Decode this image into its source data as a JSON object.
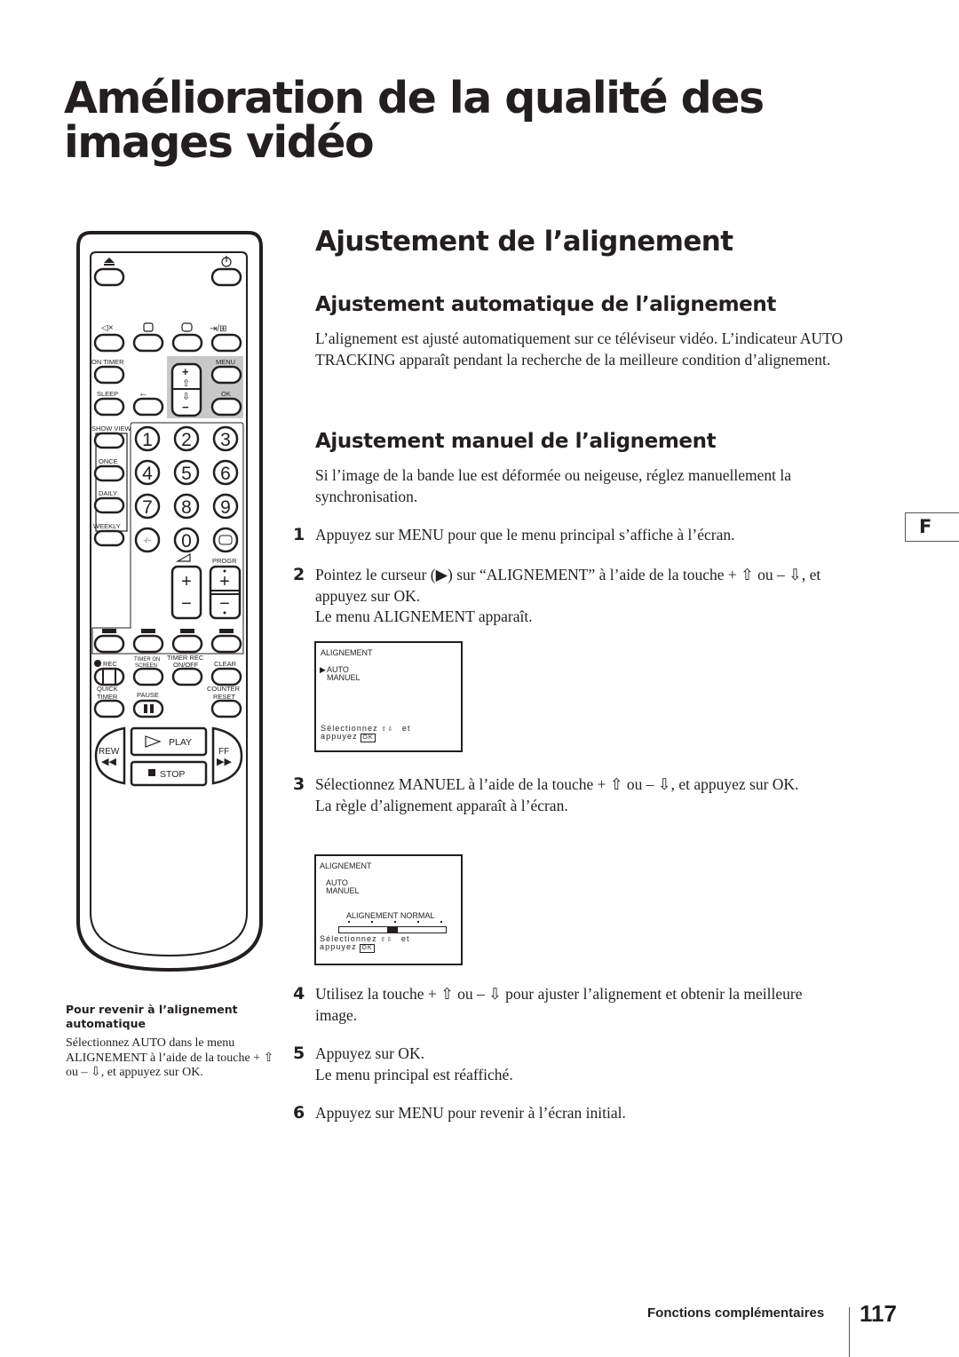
{
  "page": {
    "title": "Amélioration de la qualité des images vidéo",
    "section_title": "Ajustement de l’alignement",
    "language_tab": "F",
    "footer_label": "Fonctions complémentaires",
    "page_number": "117"
  },
  "auto_section": {
    "heading": "Ajustement automatique de l’alignement",
    "body": "L’alignement est ajusté automatiquement sur ce téléviseur vidéo. L’indicateur AUTO TRACKING apparaît pendant la recherche de la meilleure condition d’alignement."
  },
  "manual_section": {
    "heading": "Ajustement manuel de l’alignement",
    "body": "Si l’image de la bande lue est déformée ou neigeuse, réglez manuellement la synchronisation.",
    "steps": [
      {
        "number": "1",
        "text": "Appuyez sur MENU pour que le menu principal s’affiche à l’écran.",
        "note": ""
      },
      {
        "number": "2",
        "text": "Pointez le curseur (▶) sur “ALIGNEMENT” à l’aide de la touche + ⇧ ou – ⇩, et appuyez sur OK.",
        "note": "Le menu ALIGNEMENT apparaît."
      },
      {
        "number": "3",
        "text": "Sélectionnez MANUEL à l’aide de la touche + ⇧ ou – ⇩, et appuyez sur OK.",
        "note": "La règle d’alignement apparaît à l’écran."
      },
      {
        "number": "4",
        "text": "Utilisez la touche + ⇧ ou – ⇩ pour ajuster l’alignement et obtenir la meilleure image.",
        "note": ""
      },
      {
        "number": "5",
        "text": "Appuyez sur OK.",
        "note": "Le menu principal est réaffiché."
      },
      {
        "number": "6",
        "text": "Appuyez sur MENU pour revenir à l’écran initial.",
        "note": ""
      }
    ]
  },
  "screen_1": {
    "title": "ALIGNEMENT",
    "cursor": "▶",
    "options": [
      "AUTO",
      "MANUEL"
    ],
    "selected": "AUTO",
    "hint_line1": "Sélectionnez ⇳ et",
    "hint_select": "Sélectionnez",
    "hint_arrows": "⇧⇩",
    "hint_et": "et",
    "hint_press": "appuyez",
    "ok_label": "OK"
  },
  "screen_2": {
    "title": "ALIGNEMENT",
    "options": [
      "AUTO",
      "MANUEL"
    ],
    "scale_label": "ALIGNEMENT NORMAL",
    "scale_ticks": 5,
    "scale_position": 0.5,
    "hint_select": "Sélectionnez",
    "hint_arrows": "⇧⇩",
    "hint_et": "et",
    "hint_press": "appuyez",
    "ok_label": "OK"
  },
  "sidebar_note": {
    "title": "Pour revenir à l’alignement automatique",
    "body": "Sélectionnez AUTO dans le menu ALIGNEMENT à l’aide de la touche + ⇧ ou – ⇩, et appuyez sur OK."
  },
  "remote": {
    "labels": {
      "on_timer": "ON TIMER",
      "menu": "MENU",
      "sleep": "SLEEP",
      "ok": "OK",
      "show_view": "SHOW VIEW",
      "once": "ONCE",
      "daily": "DAILY",
      "weekly": "WEEKLY",
      "progr": "PROGR",
      "rec": "REC",
      "timer_on_screen_1": "TIMER ON",
      "timer_on_screen_2": "SCREEN",
      "timer_rec": "TIMER REC",
      "on_off": "ON/OFF",
      "clear": "CLEAR",
      "quick_1": "QUICK",
      "quick_2": "TIMER",
      "pause": "PAUSE",
      "counter_1": "COUNTER",
      "counter_2": "RESET",
      "rew": "REW",
      "ff": "FF",
      "play": "PLAY",
      "stop": "STOP",
      "dash": "-/--"
    },
    "digits": [
      "1",
      "2",
      "3",
      "4",
      "5",
      "6",
      "7",
      "8",
      "9"
    ],
    "zero": "0",
    "plus": "+",
    "minus": "−"
  }
}
